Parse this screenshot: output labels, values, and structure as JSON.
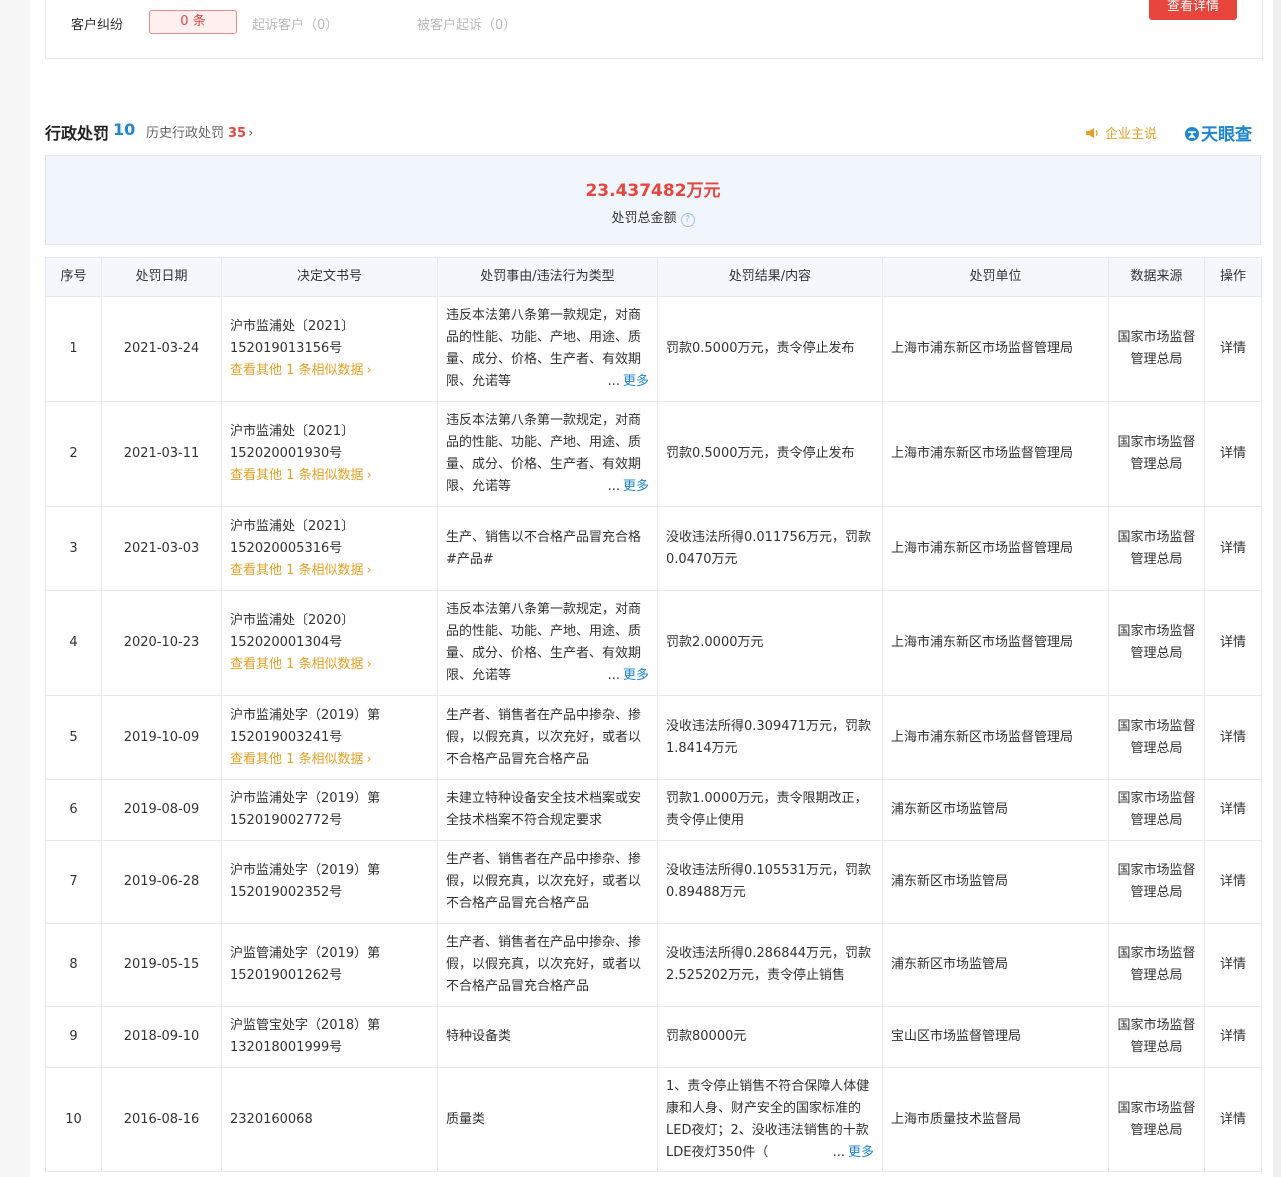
{
  "top_card": {
    "label": "客户纠纷",
    "badge": "0 条",
    "sued_customer": "起诉客户（0）",
    "sued_by_customer": "被客户起诉（0）",
    "view_button": "查看详情"
  },
  "section": {
    "title": "行政处罚",
    "count": "10",
    "history_label": "历史行政处罚",
    "history_count": "35",
    "enterprise_say": "企业主说",
    "brand": "天眼查"
  },
  "summary": {
    "amount": "23.437482万元",
    "label": "处罚总金额"
  },
  "table": {
    "headers": [
      "序号",
      "处罚日期",
      "决定文书号",
      "处罚事由/违法行为类型",
      "处罚结果/内容",
      "处罚单位",
      "数据来源",
      "操作"
    ],
    "similar_text": "查看其他 1 条相似数据",
    "more_text": "更多",
    "ellipsis": "...",
    "detail_text": "详情",
    "rows": [
      {
        "no": "1",
        "date": "2021-03-24",
        "doc": "沪市监浦处〔2021〕152019013156号",
        "reason": "违反本法第八条第一款规定，对商品的性能、功能、产地、用途、质量、成分、价格、生产者、有效期限、允诺等",
        "result": "罚款0.5000万元，责令停止发布",
        "unit": "上海市浦东新区市场监督管理局",
        "source": "国家市场监督管理总局"
      },
      {
        "no": "2",
        "date": "2021-03-11",
        "doc": "沪市监浦处〔2021〕152020001930号",
        "reason": "违反本法第八条第一款规定，对商品的性能、功能、产地、用途、质量、成分、价格、生产者、有效期限、允诺等",
        "result": "罚款0.5000万元，责令停止发布",
        "unit": "上海市浦东新区市场监督管理局",
        "source": "国家市场监督管理总局"
      },
      {
        "no": "3",
        "date": "2021-03-03",
        "doc": "沪市监浦处〔2021〕152020005316号",
        "reason": "生产、销售以不合格产品冒充合格#产品#",
        "result": "没收违法所得0.011756万元，罚款0.0470万元",
        "unit": "上海市浦东新区市场监督管理局",
        "source": "国家市场监督管理总局"
      },
      {
        "no": "4",
        "date": "2020-10-23",
        "doc": "沪市监浦处〔2020〕152020001304号",
        "reason": "违反本法第八条第一款规定，对商品的性能、功能、产地、用途、质量、成分、价格、生产者、有效期限、允诺等",
        "result": "罚款2.0000万元",
        "unit": "上海市浦东新区市场监督管理局",
        "source": "国家市场监督管理总局"
      },
      {
        "no": "5",
        "date": "2019-10-09",
        "doc": "沪市监浦处字（2019）第152019003241号",
        "reason": "生产者、销售者在产品中掺杂、掺假，以假充真，以次充好，或者以不合格产品冒充合格产品",
        "result": "没收违法所得0.309471万元，罚款1.8414万元",
        "unit": "上海市浦东新区市场监督管理局",
        "source": "国家市场监督管理总局"
      },
      {
        "no": "6",
        "date": "2019-08-09",
        "doc": "沪市监浦处字（2019）第152019002772号",
        "reason": "未建立特种设备安全技术档案或安全技术档案不符合规定要求",
        "result": "罚款1.0000万元，责令限期改正，责令停止使用",
        "unit": "浦东新区市场监管局",
        "source": "国家市场监督管理总局"
      },
      {
        "no": "7",
        "date": "2019-06-28",
        "doc": "沪市监浦处字（2019）第152019002352号",
        "reason": "生产者、销售者在产品中掺杂、掺假，以假充真，以次充好，或者以不合格产品冒充合格产品",
        "result": "没收违法所得0.105531万元，罚款0.89488万元",
        "unit": "浦东新区市场监管局",
        "source": "国家市场监督管理总局"
      },
      {
        "no": "8",
        "date": "2019-05-15",
        "doc": "沪监管浦处字（2019）第152019001262号",
        "reason": "生产者、销售者在产品中掺杂、掺假，以假充真，以次充好，或者以不合格产品冒充合格产品",
        "result": "没收违法所得0.286844万元，罚款2.525202万元，责令停止销售",
        "unit": "浦东新区市场监管局",
        "source": "国家市场监督管理总局"
      },
      {
        "no": "9",
        "date": "2018-09-10",
        "doc": "沪监管宝处字（2018）第132018001999号",
        "reason": "特种设备类",
        "result": "罚款80000元",
        "unit": "宝山区市场监督管理局",
        "source": "国家市场监督管理总局"
      },
      {
        "no": "10",
        "date": "2016-08-16",
        "doc": "2320160068",
        "reason": "质量类",
        "result": "1、责令停止销售不符合保障人体健康和人身、财产安全的国家标准的LED夜灯；2、没收违法销售的十款LDE夜灯350件（",
        "unit": "上海市质量技术监督局",
        "source": "国家市场监督管理总局"
      }
    ]
  }
}
